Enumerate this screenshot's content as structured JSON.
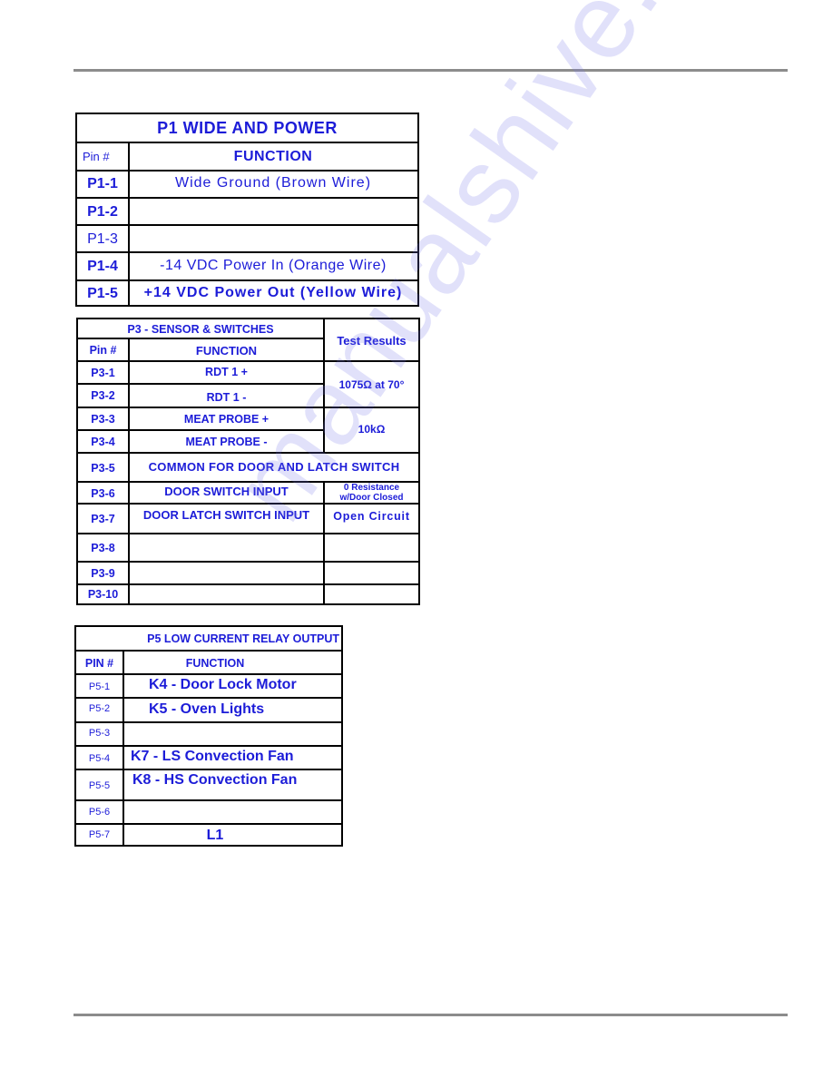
{
  "page": {
    "watermark": "manualshive.com",
    "text_color": "#1c1cd8",
    "rule_color": "#8c8c8c"
  },
  "p1": {
    "title": "P1  WIDE AND POWER",
    "pin_header": "Pin #",
    "function_header": "FUNCTION",
    "rows": [
      {
        "pin": "P1-1",
        "function": "Wide Ground (Brown Wire)"
      },
      {
        "pin": "P1-2",
        "function": ""
      },
      {
        "pin": "P1-3",
        "function": ""
      },
      {
        "pin": "P1-4",
        "function": "-14 VDC Power In (Orange Wire)"
      },
      {
        "pin": "P1-5",
        "function": "+14 VDC Power Out (Yellow Wire)"
      }
    ]
  },
  "p3": {
    "title": "P3 - SENSOR & SWITCHES",
    "pin_header": "Pin #",
    "function_header": "FUNCTION",
    "results_header": "Test Results",
    "rows": [
      {
        "pin": "P3-1",
        "function": "RDT  1 +"
      },
      {
        "pin": "P3-2",
        "function": "RDT  1  -"
      },
      {
        "pin": "P3-3",
        "function": "MEAT PROBE  +"
      },
      {
        "pin": "P3-4",
        "function": "MEAT PROBE  -"
      },
      {
        "pin": "P3-5",
        "function": "COMMON FOR DOOR AND LATCH SWITCH"
      },
      {
        "pin": "P3-6",
        "function": "DOOR SWITCH INPUT"
      },
      {
        "pin": "P3-7",
        "function": "DOOR LATCH SWITCH INPUT"
      },
      {
        "pin": "P3-8",
        "function": ""
      },
      {
        "pin": "P3-9",
        "function": ""
      },
      {
        "pin": "P3-10",
        "function": ""
      }
    ],
    "results": {
      "rdt": "1075Ω at 70°",
      "meat_probe": "10kΩ",
      "door_switch_line1": "0 Resistance",
      "door_switch_line2": "w/Door Closed",
      "door_latch": "Open Circuit",
      "p3_8": "",
      "p3_9": "",
      "p3_10": ""
    }
  },
  "p5": {
    "title": "P5  LOW CURRENT RELAY OUTPUT",
    "pin_header": "PIN #",
    "function_header": "FUNCTION",
    "rows": [
      {
        "pin": "P5-1",
        "function": "K4 - Door Lock Motor"
      },
      {
        "pin": "P5-2",
        "function": "K5 - Oven Lights"
      },
      {
        "pin": "P5-3",
        "function": ""
      },
      {
        "pin": "P5-4",
        "function": "K7 - LS Convection Fan"
      },
      {
        "pin": "P5-5",
        "function": "K8 - HS Convection Fan"
      },
      {
        "pin": "P5-6",
        "function": ""
      },
      {
        "pin": "P5-7",
        "function": "L1"
      }
    ]
  }
}
